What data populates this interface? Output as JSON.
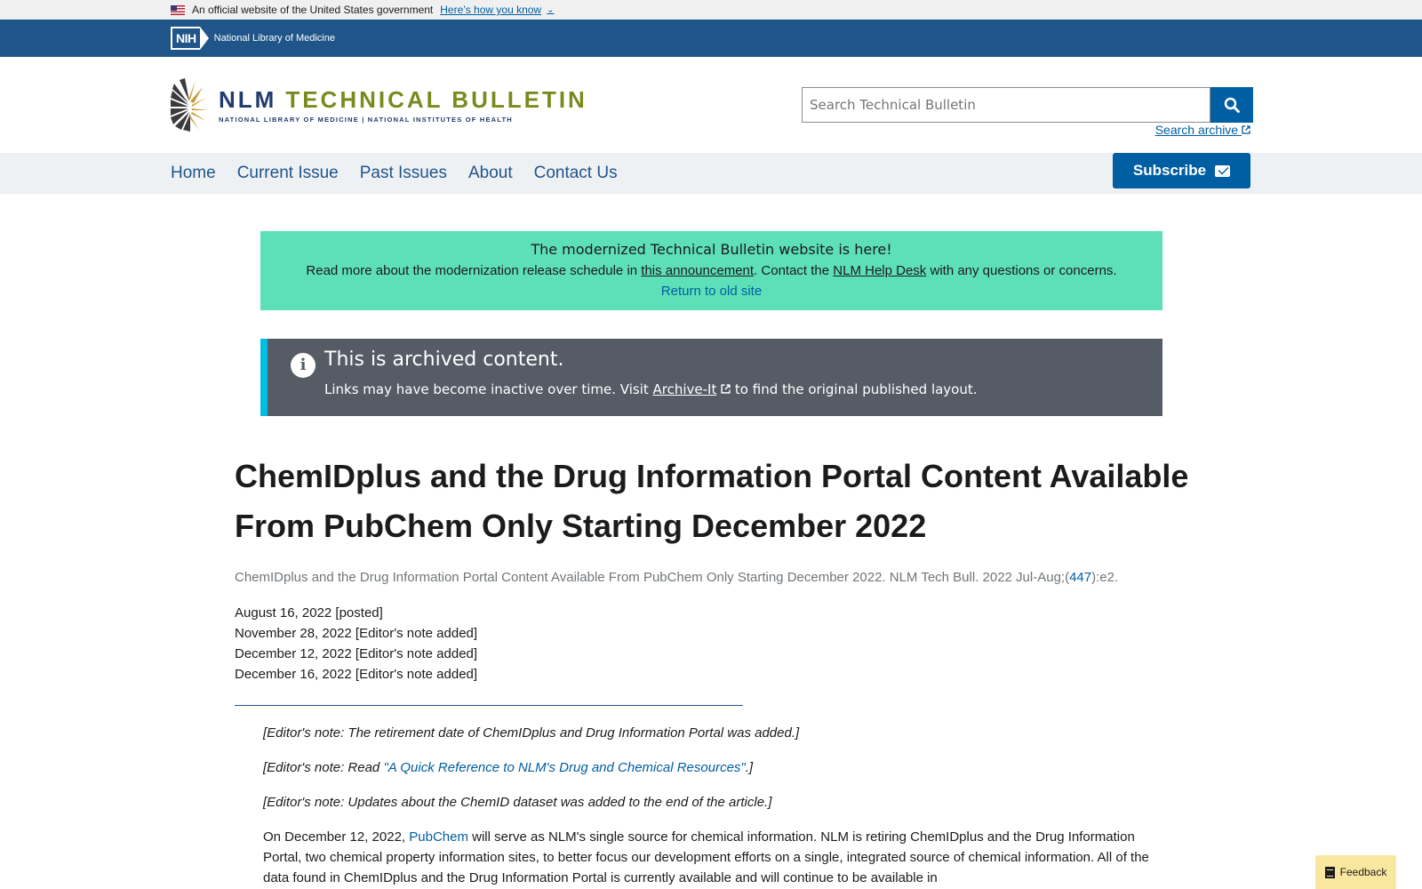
{
  "gov_banner": {
    "text": "An official website of the United States government",
    "link": "Here’s how you know"
  },
  "nih_bar": {
    "logo": "NIH",
    "name": "National Library of Medicine"
  },
  "logo": {
    "title_a": "NLM",
    "title_b": "TECHNICAL BULLETIN",
    "subtitle": "NATIONAL LIBRARY OF MEDICINE | NATIONAL INSTITUTES OF HEALTH"
  },
  "search": {
    "placeholder": "Search Technical Bulletin",
    "archive": "Search archive"
  },
  "nav": {
    "items": [
      "Home",
      "Current Issue",
      "Past Issues",
      "About",
      "Contact Us"
    ],
    "subscribe": "Subscribe"
  },
  "announce": {
    "heading": "The modernized Technical Bulletin website is here!",
    "p_a": "Read more about the modernization release schedule in ",
    "p_link1": "this announcement",
    "p_b": ". Contact the ",
    "p_link2": "NLM Help Desk",
    "p_c": " with any questions or concerns.",
    "return": "Return to old site"
  },
  "archived": {
    "heading": "This is archived content.",
    "p_a": "Links may have become inactive over time. Visit ",
    "p_link": "Archive-It",
    "p_b": " to find the original published layout."
  },
  "article": {
    "title": "ChemIDplus and the Drug Information Portal Content Available From PubChem Only Starting December 2022",
    "citation_a": "ChemIDplus and the Drug Information Portal Content Available From PubChem Only Starting December 2022. NLM Tech Bull. 2022 Jul-Aug;(",
    "citation_link": "447",
    "citation_b": "):e2.",
    "dates": [
      "August 16, 2022 [posted]",
      "November 28, 2022 [Editor's note added]",
      "December 12, 2022 [Editor's note added]",
      "December 16, 2022 [Editor's note added]"
    ],
    "note1": "[Editor's note: The retirement date of ChemIDplus and Drug Information Portal was added.]",
    "note2_a": "[Editor's note: Read ",
    "note2_link": "\"A Quick Reference to NLM's Drug and Chemical Resources\"",
    "note2_b": ".]",
    "note3": "[Editor's note: Updates about the ChemID dataset was added to the end of the article.]",
    "body_a": "On December 12, 2022, ",
    "body_link": "PubChem",
    "body_b": " will serve as NLM's single source for chemical information. NLM is retiring ChemIDplus and the Drug Information Portal, two chemical property information sites, to better focus our development efforts on a single, integrated source of chemical information. All of the data found in ChemIDplus and the Drug Information Portal is currently available and will continue to be available in"
  },
  "feedback": "Feedback"
}
